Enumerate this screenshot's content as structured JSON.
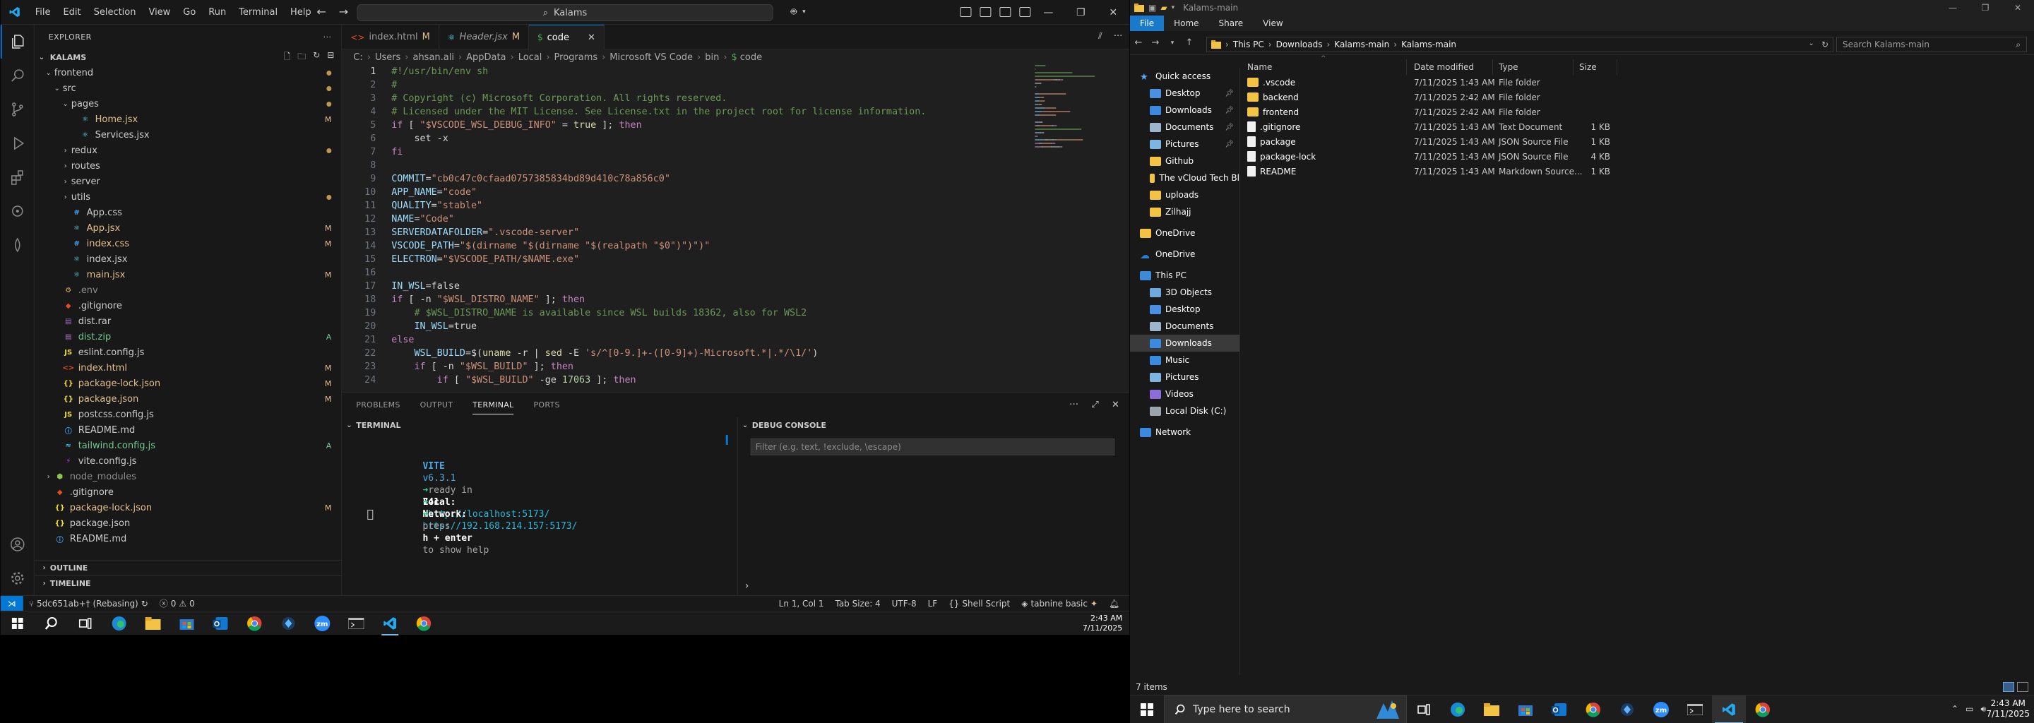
{
  "vscode": {
    "menu": [
      "File",
      "Edit",
      "Selection",
      "View",
      "Go",
      "Run",
      "Terminal",
      "Help"
    ],
    "search_center": "Kalams",
    "explorer_title": "EXPLORER",
    "workspace_name": "KALAMS",
    "tree": [
      {
        "label": "frontend",
        "depth": 1,
        "kind": "folder",
        "open": true,
        "state": "dot"
      },
      {
        "label": "src",
        "depth": 2,
        "kind": "folder",
        "open": true,
        "state": "dot"
      },
      {
        "label": "pages",
        "depth": 3,
        "kind": "folder",
        "open": true,
        "state": "dot"
      },
      {
        "label": "Home.jsx",
        "depth": 4,
        "kind": "jsx",
        "state": "mod",
        "badge": "M"
      },
      {
        "label": "Services.jsx",
        "depth": 4,
        "kind": "jsx",
        "state": "",
        "badge": ""
      },
      {
        "label": "redux",
        "depth": 3,
        "kind": "folder",
        "open": false,
        "state": "dot"
      },
      {
        "label": "routes",
        "depth": 3,
        "kind": "folder",
        "open": false,
        "state": ""
      },
      {
        "label": "server",
        "depth": 3,
        "kind": "folder",
        "open": false,
        "state": ""
      },
      {
        "label": "utils",
        "depth": 3,
        "kind": "folder",
        "open": false,
        "state": "dot"
      },
      {
        "label": "App.css",
        "depth": 3,
        "kind": "css",
        "state": "",
        "badge": ""
      },
      {
        "label": "App.jsx",
        "depth": 3,
        "kind": "jsx",
        "state": "mod",
        "badge": "M"
      },
      {
        "label": "index.css",
        "depth": 3,
        "kind": "css",
        "state": "mod",
        "badge": "M"
      },
      {
        "label": "index.jsx",
        "depth": 3,
        "kind": "jsx",
        "state": "",
        "badge": ""
      },
      {
        "label": "main.jsx",
        "depth": 3,
        "kind": "jsx",
        "state": "mod",
        "badge": "M"
      },
      {
        "label": ".env",
        "depth": 2,
        "kind": "env",
        "state": "ign",
        "badge": ""
      },
      {
        "label": ".gitignore",
        "depth": 2,
        "kind": "git",
        "state": "",
        "badge": ""
      },
      {
        "label": "dist.rar",
        "depth": 2,
        "kind": "rar",
        "state": "",
        "badge": ""
      },
      {
        "label": "dist.zip",
        "depth": 2,
        "kind": "zip",
        "state": "add",
        "badge": "A"
      },
      {
        "label": "eslint.config.js",
        "depth": 2,
        "kind": "js",
        "state": "",
        "badge": ""
      },
      {
        "label": "index.html",
        "depth": 2,
        "kind": "html",
        "state": "mod",
        "badge": "M"
      },
      {
        "label": "package-lock.json",
        "depth": 2,
        "kind": "json",
        "state": "mod",
        "badge": "M"
      },
      {
        "label": "package.json",
        "depth": 2,
        "kind": "json",
        "state": "mod",
        "badge": "M"
      },
      {
        "label": "postcss.config.js",
        "depth": 2,
        "kind": "js",
        "state": "",
        "badge": ""
      },
      {
        "label": "README.md",
        "depth": 2,
        "kind": "md",
        "state": "",
        "badge": ""
      },
      {
        "label": "tailwind.config.js",
        "depth": 2,
        "kind": "tw",
        "state": "add",
        "badge": "A"
      },
      {
        "label": "vite.config.js",
        "depth": 2,
        "kind": "vite",
        "state": "",
        "badge": ""
      },
      {
        "label": "node_modules",
        "depth": 1,
        "kind": "node",
        "open": false,
        "state": "ign"
      },
      {
        "label": ".gitignore",
        "depth": 1,
        "kind": "git",
        "state": "",
        "badge": ""
      },
      {
        "label": "package-lock.json",
        "depth": 1,
        "kind": "json",
        "state": "mod",
        "badge": "M"
      },
      {
        "label": "package.json",
        "depth": 1,
        "kind": "json",
        "state": "",
        "badge": ""
      },
      {
        "label": "README.md",
        "depth": 1,
        "kind": "md",
        "state": "",
        "badge": ""
      }
    ],
    "outline_label": "OUTLINE",
    "timeline_label": "TIMELINE",
    "tabs": [
      {
        "label": "index.html",
        "mod": "M",
        "icon": "html",
        "italic": false,
        "active": false
      },
      {
        "label": "Header.jsx",
        "mod": "M",
        "icon": "jsx",
        "italic": true,
        "active": false
      },
      {
        "label": "code",
        "mod": "",
        "icon": "sh",
        "italic": false,
        "active": true
      }
    ],
    "breadcrumb": [
      "C:",
      "Users",
      "ahsan.ali",
      "AppData",
      "Local",
      "Programs",
      "Microsoft VS Code",
      "bin",
      "code"
    ],
    "code_lines": [
      [
        {
          "t": "#!/usr/bin/env sh",
          "c": "cm"
        }
      ],
      [
        {
          "t": "#",
          "c": "cm"
        }
      ],
      [
        {
          "t": "# Copyright (c) Microsoft Corporation. All rights reserved.",
          "c": "cm"
        }
      ],
      [
        {
          "t": "# Licensed under the MIT License. See License.txt in the project root for license information.",
          "c": "cm"
        }
      ],
      [
        {
          "t": "if",
          "c": "kw"
        },
        {
          "t": " [ ",
          "c": "pl"
        },
        {
          "t": "\"$VSCODE_WSL_DEBUG_INFO\"",
          "c": "str"
        },
        {
          "t": " = ",
          "c": "pl"
        },
        {
          "t": "true",
          "c": "fn"
        },
        {
          "t": " ]; ",
          "c": "pl"
        },
        {
          "t": "then",
          "c": "kw"
        }
      ],
      [
        {
          "t": "    set -x",
          "c": "pl"
        }
      ],
      [
        {
          "t": "fi",
          "c": "kw"
        }
      ],
      [
        {
          "t": "",
          "c": "pl"
        }
      ],
      [
        {
          "t": "COMMIT",
          "c": "var"
        },
        {
          "t": "=",
          "c": "op"
        },
        {
          "t": "\"cb0c47c0cfaad0757385834bd89d410c78a856c0\"",
          "c": "str"
        }
      ],
      [
        {
          "t": "APP_NAME",
          "c": "var"
        },
        {
          "t": "=",
          "c": "op"
        },
        {
          "t": "\"code\"",
          "c": "str"
        }
      ],
      [
        {
          "t": "QUALITY",
          "c": "var"
        },
        {
          "t": "=",
          "c": "op"
        },
        {
          "t": "\"stable\"",
          "c": "str"
        }
      ],
      [
        {
          "t": "NAME",
          "c": "var"
        },
        {
          "t": "=",
          "c": "op"
        },
        {
          "t": "\"Code\"",
          "c": "str"
        }
      ],
      [
        {
          "t": "SERVERDATAFOLDER",
          "c": "var"
        },
        {
          "t": "=",
          "c": "op"
        },
        {
          "t": "\".vscode-server\"",
          "c": "str"
        }
      ],
      [
        {
          "t": "VSCODE_PATH",
          "c": "var"
        },
        {
          "t": "=",
          "c": "op"
        },
        {
          "t": "\"$(dirname \"$(dirname \"$(realpath \"$0\")\")\")\"",
          "c": "str"
        }
      ],
      [
        {
          "t": "ELECTRON",
          "c": "var"
        },
        {
          "t": "=",
          "c": "op"
        },
        {
          "t": "\"$VSCODE_PATH/$NAME.exe\"",
          "c": "str"
        }
      ],
      [
        {
          "t": "",
          "c": "pl"
        }
      ],
      [
        {
          "t": "IN_WSL",
          "c": "var"
        },
        {
          "t": "=",
          "c": "op"
        },
        {
          "t": "false",
          "c": "pl"
        }
      ],
      [
        {
          "t": "if",
          "c": "kw"
        },
        {
          "t": " [ -n ",
          "c": "pl"
        },
        {
          "t": "\"$WSL_DISTRO_NAME\"",
          "c": "str"
        },
        {
          "t": " ]; ",
          "c": "pl"
        },
        {
          "t": "then",
          "c": "kw"
        }
      ],
      [
        {
          "t": "    # $WSL_DISTRO_NAME is available since WSL builds 18362, also for WSL2",
          "c": "cm"
        }
      ],
      [
        {
          "t": "    IN_WSL",
          "c": "var"
        },
        {
          "t": "=",
          "c": "op"
        },
        {
          "t": "true",
          "c": "pl"
        }
      ],
      [
        {
          "t": "else",
          "c": "kw"
        }
      ],
      [
        {
          "t": "    WSL_BUILD",
          "c": "var"
        },
        {
          "t": "=$(",
          "c": "op"
        },
        {
          "t": "uname",
          "c": "fn"
        },
        {
          "t": " -r | ",
          "c": "pl"
        },
        {
          "t": "sed",
          "c": "fn"
        },
        {
          "t": " -E ",
          "c": "pl"
        },
        {
          "t": "'s/^[0-9.]+-([0-9]+)-Microsoft.*|.*/\\1/'",
          "c": "str"
        },
        {
          "t": ")",
          "c": "op"
        }
      ],
      [
        {
          "t": "    if",
          "c": "kw"
        },
        {
          "t": " [ -n ",
          "c": "pl"
        },
        {
          "t": "\"$WSL_BUILD\"",
          "c": "str"
        },
        {
          "t": " ]; ",
          "c": "pl"
        },
        {
          "t": "then",
          "c": "kw"
        }
      ],
      [
        {
          "t": "        if",
          "c": "kw"
        },
        {
          "t": " [ ",
          "c": "pl"
        },
        {
          "t": "\"$WSL_BUILD\"",
          "c": "str"
        },
        {
          "t": " -ge ",
          "c": "pl"
        },
        {
          "t": "17063",
          "c": "num"
        },
        {
          "t": " ]; ",
          "c": "pl"
        },
        {
          "t": "then",
          "c": "kw"
        }
      ]
    ],
    "panel_tabs": [
      "PROBLEMS",
      "OUTPUT",
      "TERMINAL",
      "PORTS"
    ],
    "terminal_head": "TERMINAL",
    "debug_head": "DEBUG CONSOLE",
    "debug_filter_placeholder": "Filter (e.g. text, !exclude, \\escape)",
    "terminal": {
      "vite_name": "VITE",
      "vite_version": "v6.3.1",
      "ready": "ready in",
      "ready_ms": "741",
      "ms": "ms",
      "local_label": "Local:",
      "local_url": "http://localhost:5173/",
      "network_label": "Network:",
      "network_url": "http://192.168.214.157:5173/",
      "help_pre": "press",
      "help_key": "h + enter",
      "help_post": "to show help"
    },
    "status": {
      "branch": "5dc651ab+† (Rebasing)",
      "errors": "0",
      "warnings": "0",
      "position": "Ln 1, Col 1",
      "tab_size": "Tab Size: 4",
      "encoding": "UTF-8",
      "eol": "LF",
      "language": "Shell Script",
      "tabnine": "tabnine basic"
    },
    "clock_time": "2:43 AM",
    "clock_date": "7/11/2025"
  },
  "explorer": {
    "title": "Kalams-main",
    "ribbon_tabs": [
      "File",
      "Home",
      "Share",
      "View"
    ],
    "address": [
      "This PC",
      "Downloads",
      "Kalams-main",
      "Kalams-main"
    ],
    "search_placeholder": "Search Kalams-main",
    "nav": [
      {
        "label": "Quick access",
        "kind": "star",
        "indent": 0,
        "pin": false,
        "sel": false
      },
      {
        "label": "Desktop",
        "kind": "desk",
        "indent": 1,
        "pin": true,
        "sel": false
      },
      {
        "label": "Downloads",
        "kind": "dl",
        "indent": 1,
        "pin": true,
        "sel": false
      },
      {
        "label": "Documents",
        "kind": "docs",
        "indent": 1,
        "pin": true,
        "sel": false
      },
      {
        "label": "Pictures",
        "kind": "pics",
        "indent": 1,
        "pin": true,
        "sel": false
      },
      {
        "label": "Github",
        "kind": "folder",
        "indent": 1,
        "pin": false,
        "sel": false
      },
      {
        "label": "The vCloud Tech Bl",
        "kind": "folder",
        "indent": 1,
        "pin": false,
        "sel": false
      },
      {
        "label": "uploads",
        "kind": "folder",
        "indent": 1,
        "pin": false,
        "sel": false
      },
      {
        "label": "Zilhajj",
        "kind": "folder",
        "indent": 1,
        "pin": false,
        "sel": false
      },
      {
        "label": "",
        "kind": "gap",
        "indent": 0,
        "pin": false,
        "sel": false
      },
      {
        "label": "OneDrive",
        "kind": "folder",
        "indent": 0,
        "pin": false,
        "sel": false
      },
      {
        "label": "",
        "kind": "gap",
        "indent": 0,
        "pin": false,
        "sel": false
      },
      {
        "label": "OneDrive",
        "kind": "cloud",
        "indent": 0,
        "pin": false,
        "sel": false
      },
      {
        "label": "",
        "kind": "gap",
        "indent": 0,
        "pin": false,
        "sel": false
      },
      {
        "label": "This PC",
        "kind": "pc",
        "indent": 0,
        "pin": false,
        "sel": false
      },
      {
        "label": "3D Objects",
        "kind": "obj",
        "indent": 1,
        "pin": false,
        "sel": false
      },
      {
        "label": "Desktop",
        "kind": "desk",
        "indent": 1,
        "pin": false,
        "sel": false
      },
      {
        "label": "Documents",
        "kind": "docs",
        "indent": 1,
        "pin": false,
        "sel": false
      },
      {
        "label": "Downloads",
        "kind": "dl",
        "indent": 1,
        "pin": false,
        "sel": true
      },
      {
        "label": "Music",
        "kind": "music",
        "indent": 1,
        "pin": false,
        "sel": false
      },
      {
        "label": "Pictures",
        "kind": "pics",
        "indent": 1,
        "pin": false,
        "sel": false
      },
      {
        "label": "Videos",
        "kind": "vid",
        "indent": 1,
        "pin": false,
        "sel": false
      },
      {
        "label": "Local Disk (C:)",
        "kind": "disk",
        "indent": 1,
        "pin": false,
        "sel": false
      },
      {
        "label": "",
        "kind": "gap",
        "indent": 0,
        "pin": false,
        "sel": false
      },
      {
        "label": "Network",
        "kind": "net",
        "indent": 0,
        "pin": false,
        "sel": false
      }
    ],
    "columns": [
      "Name",
      "Date modified",
      "Type",
      "Size"
    ],
    "files": [
      {
        "name": ".vscode",
        "date": "7/11/2025 1:43 AM",
        "type": "File folder",
        "size": "",
        "kind": "folder"
      },
      {
        "name": "backend",
        "date": "7/11/2025 2:42 AM",
        "type": "File folder",
        "size": "",
        "kind": "folder"
      },
      {
        "name": "frontend",
        "date": "7/11/2025 2:42 AM",
        "type": "File folder",
        "size": "",
        "kind": "folder"
      },
      {
        "name": ".gitignore",
        "date": "7/11/2025 1:43 AM",
        "type": "Text Document",
        "size": "1 KB",
        "kind": "doc"
      },
      {
        "name": "package",
        "date": "7/11/2025 1:43 AM",
        "type": "JSON Source File",
        "size": "1 KB",
        "kind": "doc"
      },
      {
        "name": "package-lock",
        "date": "7/11/2025 1:43 AM",
        "type": "JSON Source File",
        "size": "4 KB",
        "kind": "doc"
      },
      {
        "name": "README",
        "date": "7/11/2025 1:43 AM",
        "type": "Markdown Source...",
        "size": "1 KB",
        "kind": "md"
      }
    ],
    "item_count": "7 items",
    "taskbar_search": "Type here to search",
    "clock_time": "2:43 AM",
    "clock_date": "7/11/2025"
  }
}
